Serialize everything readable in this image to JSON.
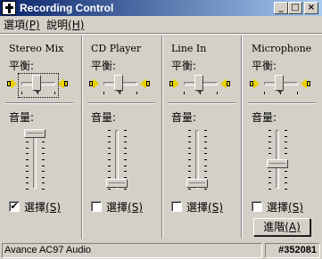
{
  "window": {
    "title": "Recording Control"
  },
  "menu": [
    {
      "label": "選項",
      "mnemonic": "(P)"
    },
    {
      "label": "說明",
      "mnemonic": "(H)"
    }
  ],
  "labels": {
    "balance": "平衡:",
    "volume": "音量:",
    "select": "選擇",
    "select_key": "(S)"
  },
  "channels": [
    {
      "name": "Stereo Mix",
      "selected": true,
      "check_mark": "✔",
      "volume_level": 0.95
    },
    {
      "name": "CD Player",
      "selected": false,
      "check_mark": "",
      "volume_level": 0.05
    },
    {
      "name": "Line In",
      "selected": false,
      "check_mark": "",
      "volume_level": 0.05
    },
    {
      "name": "Microphone",
      "selected": false,
      "check_mark": "",
      "volume_level": 0.4,
      "advanced_label": "進階",
      "advanced_key": "(A)"
    }
  ],
  "status": {
    "device": "Avance AC97 Audio",
    "id": "#352081"
  },
  "colors": {
    "title_start": "#0a246a",
    "title_end": "#a6caf0",
    "face": "#d4d0c8",
    "speaker": "#e8d000"
  }
}
